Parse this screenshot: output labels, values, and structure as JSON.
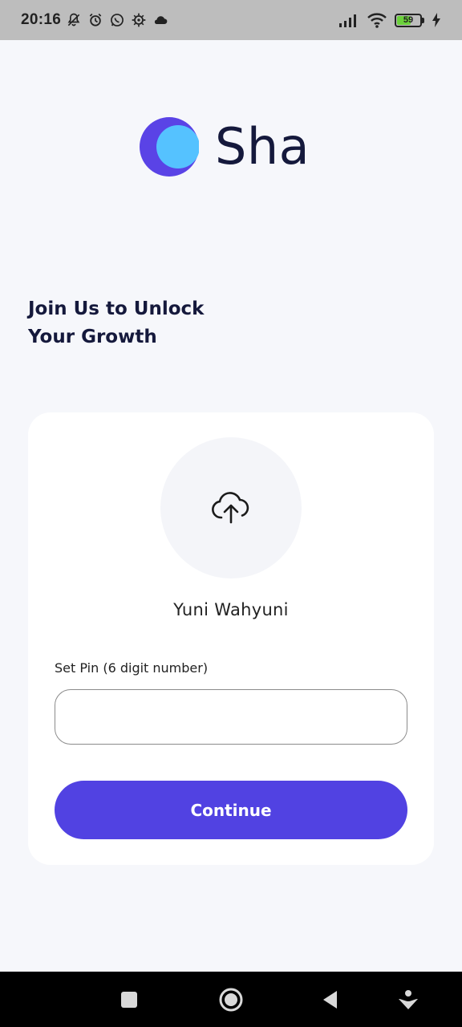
{
  "status_bar": {
    "time": "20:16",
    "left_icons": [
      "muted-notifications-icon",
      "alarm-icon",
      "whatsapp-icon",
      "settings-gear-icon",
      "cloud-icon"
    ],
    "right_icons": [
      "signal-icon",
      "wifi-icon"
    ],
    "battery_level": "59",
    "battery_percent": 59,
    "charging": true
  },
  "app": {
    "logo_text": "Sha",
    "headline_line1": "Join Us to Unlock",
    "headline_line2": "Your Growth"
  },
  "form": {
    "upload_icon": "cloud-upload-icon",
    "user_name": "Yuni Wahyuni",
    "pin_label": "Set Pin (6 digit number)",
    "pin_value": "",
    "pin_placeholder": "",
    "continue_label": "Continue"
  },
  "nav": {
    "buttons": [
      "recents-square-icon",
      "home-circle-icon",
      "back-triangle-icon",
      "assistant-icon"
    ]
  },
  "colors": {
    "accent": "#5142e2",
    "logo_dark": "#15193c",
    "logo_purple": "#5a43e6",
    "logo_blue": "#55c2ff",
    "background": "#f6f7fb"
  }
}
